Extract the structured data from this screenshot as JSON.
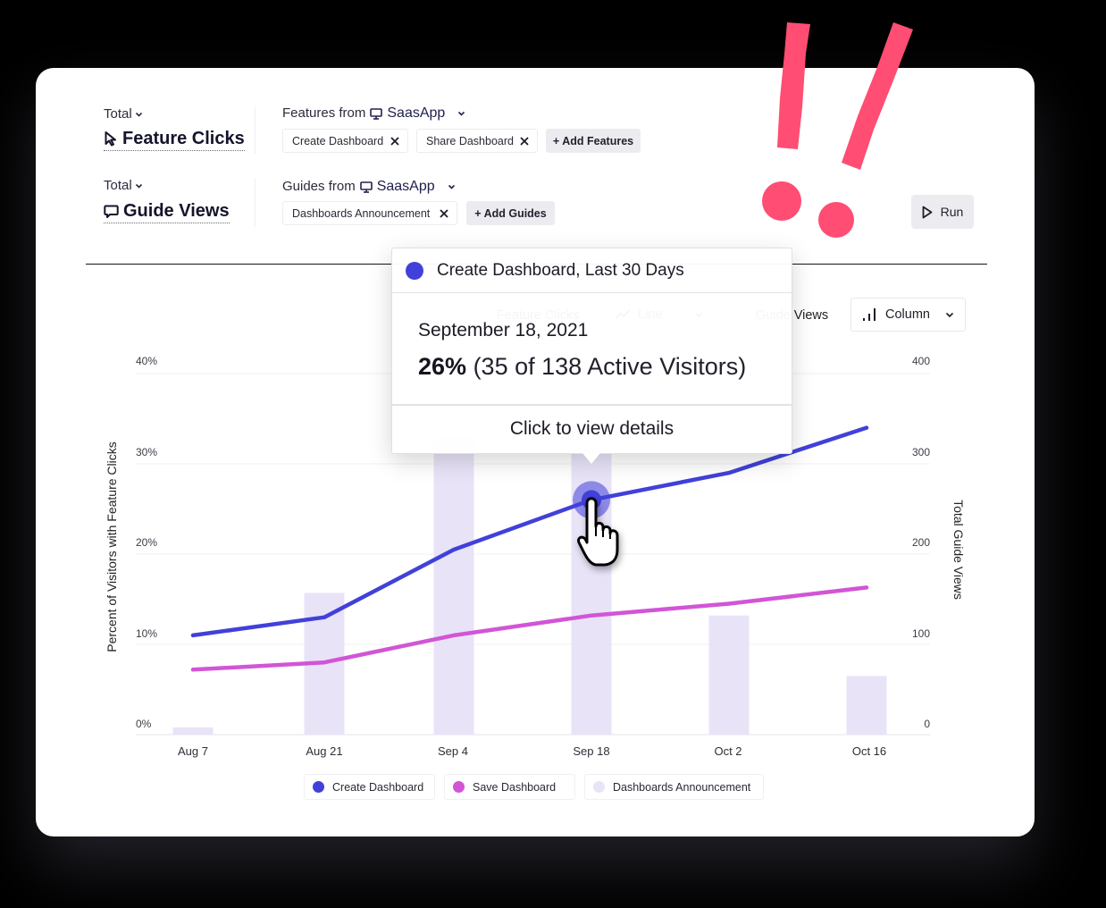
{
  "colors": {
    "background": "#000000",
    "card": "#ffffff",
    "decoration": "#ff4d73",
    "button_bg": "#ececf0"
  },
  "query": {
    "rows": [
      {
        "aggregation": "Total",
        "metric": "Feature Clicks",
        "metric_icon": "cursor-icon",
        "source_label": "Features from",
        "source_icon": "monitor-icon",
        "source_app": "SaasApp",
        "items": [
          "Create Dashboard",
          "Share Dashboard"
        ],
        "add_label": "+ Add Features"
      },
      {
        "aggregation": "Total",
        "metric": "Guide Views",
        "metric_icon": "message-icon",
        "source_label": "Guides from",
        "source_icon": "monitor-icon",
        "source_app": "SaasApp",
        "items": [
          "Dashboards Announcement"
        ],
        "add_label": "+ Add Guides"
      }
    ],
    "run_label": "Run",
    "run_icon": "play-icon"
  },
  "chart_controls": {
    "left_metric": "Feature Clicks",
    "left_type": "Line",
    "left_type_icon": "line-chart-icon",
    "right_metric": "Guide Views",
    "right_type": "Column",
    "right_type_icon": "column-chart-icon"
  },
  "tooltip": {
    "series": "Create Dashboard, Last 30 Days",
    "color": "#4141d9",
    "date": "September 18, 2021",
    "percent": "26%",
    "detail": "(35 of 138 Active Visitors)",
    "action": "Click to view details"
  },
  "chart_data": {
    "type": "line",
    "categories": [
      "Aug 7",
      "Aug 21",
      "Sep 4",
      "Sep 18",
      "Oct 2",
      "Oct 16"
    ],
    "series": [
      {
        "name": "Create Dashboard",
        "type": "line",
        "axis": "left",
        "color": "#4141d9",
        "values": [
          11,
          13,
          20.5,
          26,
          29,
          34
        ]
      },
      {
        "name": "Save Dashboard",
        "type": "line",
        "axis": "left",
        "color": "#d255d6",
        "values": [
          7.2,
          8,
          11,
          13.2,
          14.5,
          16.3
        ]
      },
      {
        "name": "Dashboards Announcement",
        "type": "bar",
        "axis": "right",
        "color": "#e9e3f8",
        "values": [
          8,
          157,
          330,
          320,
          132,
          65
        ]
      }
    ],
    "xlabel": "",
    "ylabel": "Percent of Visitors with Feature Clicks",
    "y2label": "Total Guide Views",
    "ylim": [
      0,
      40
    ],
    "y_ticks": [
      "0%",
      "10%",
      "20%",
      "30%",
      "40%"
    ],
    "y_tick_values": [
      0,
      10,
      20,
      30,
      40
    ],
    "y2lim": [
      0,
      400
    ],
    "y2_ticks": [
      "0",
      "100",
      "200",
      "300",
      "400"
    ],
    "grid": true,
    "legend_position": "bottom",
    "legend": [
      "Create Dashboard",
      "Save Dashboard",
      "Dashboards Announcement"
    ],
    "highlight": {
      "series": "Create Dashboard",
      "category": "Sep 18",
      "value": 26
    }
  }
}
